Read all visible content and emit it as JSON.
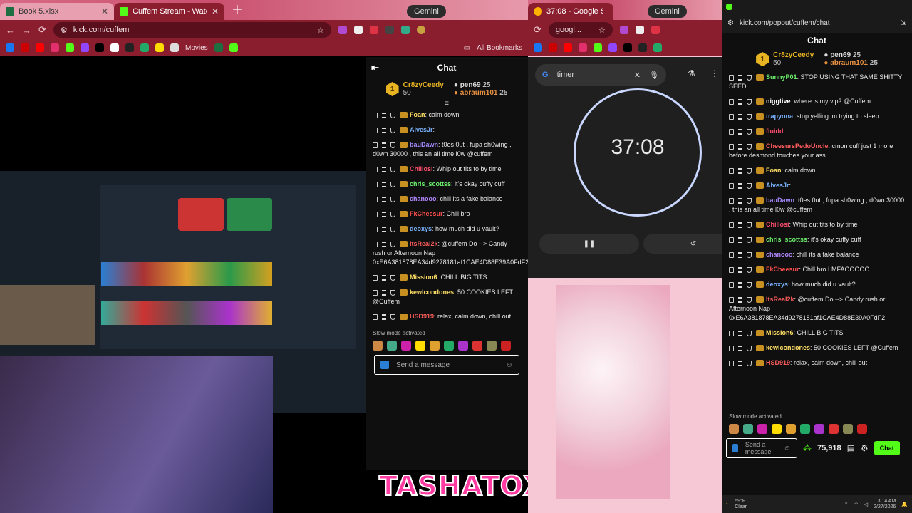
{
  "left_window": {
    "tabs": [
      {
        "label": "Book 5.xlsx",
        "color": "#1d6f42"
      },
      {
        "label": "Cuffem Stream - Watch Li...",
        "color": "#53fc18"
      }
    ],
    "gemini": "Gemini",
    "url": "kick.com/cuffem",
    "bookmarks_movies": "Movies",
    "all_bookmarks": "All Bookmarks"
  },
  "stream_chat": {
    "title": "Chat",
    "leaders": [
      {
        "name": "Cr8zyCeedy",
        "score": "50"
      },
      {
        "name": "pen69",
        "score": "25"
      },
      {
        "name": "abraum101",
        "score": "25"
      }
    ],
    "messages": [
      {
        "user": "Foan",
        "color": "#ffe066",
        "text": ": calm down"
      },
      {
        "user": "AlvesJr",
        "color": "#7ab3ff",
        "text": ":"
      },
      {
        "user": "bauDawn",
        "color": "#a58bff",
        "text": ": t0es 0ut , fupa sh0wing , d0wn 30000 , this an all time l0w @cuffem"
      },
      {
        "user": "Chillosi",
        "color": "#ff4d6d",
        "text": ": Whip out tits to by time"
      },
      {
        "user": "chris_scottss",
        "color": "#6cf06c",
        "text": ": it's okay cuffy cuff"
      },
      {
        "user": "chanooo",
        "color": "#b388ff",
        "text": ": chill its a fake balance"
      },
      {
        "user": "FkCheesur",
        "color": "#ff4d4d",
        "text": ": Chill bro"
      },
      {
        "user": "deoxys",
        "color": "#7ab3ff",
        "text": ": how much did u vault?"
      },
      {
        "user": "ItsReal2k",
        "color": "#ff5c5c",
        "text": ": @cuffem Do --> Candy rush or Afternoon Nap 0xE6A381878EA34d9278181af1CAE4D88E39A0FdF2"
      },
      {
        "user": "Mission6",
        "color": "#ffe066",
        "text": ": CHILL BIG TITS"
      },
      {
        "user": "kewlcondones",
        "color": "#ffe066",
        "text": ": 50 COOKIES LEFT @Cuffem"
      },
      {
        "user": "HSD919",
        "color": "#ff5c5c",
        "text": ": relax, calm down, chill out"
      }
    ],
    "slow_mode": "Slow mode activated",
    "send_placeholder": "Send a message"
  },
  "middle_window": {
    "tab": "37:08 - Google S...",
    "gemini": "Gemini",
    "omnibox": "googl...",
    "search": "timer",
    "timer_value": "37:08"
  },
  "popout_window": {
    "url": "kick.com/popout/cuffem/chat",
    "title": "Chat",
    "leaders": [
      {
        "name": "Cr8zyCeedy",
        "score": "50"
      },
      {
        "name": "pen69",
        "score": "25"
      },
      {
        "name": "abraum101",
        "score": "25"
      }
    ],
    "messages": [
      {
        "user": "SunnyP01",
        "color": "#6cf06c",
        "text": ": STOP USING THAT SAME SHITTY SEED"
      },
      {
        "user": "niggtive",
        "color": "#ffffff",
        "text": ": where is my vip? @Cuffem"
      },
      {
        "user": "trapyona",
        "color": "#7ab3ff",
        "text": ": stop yelling im trying to sleep"
      },
      {
        "user": "fluidd",
        "color": "#ff4d6d",
        "text": ":"
      },
      {
        "user": "CheesursPedoUncle",
        "color": "#ff5c5c",
        "text": ": cmon cuff just 1 more before desmond touches your ass"
      },
      {
        "user": "Foan",
        "color": "#ffe066",
        "text": ": calm down"
      },
      {
        "user": "AlvesJr",
        "color": "#7ab3ff",
        "text": ":"
      },
      {
        "user": "bauDawn",
        "color": "#a58bff",
        "text": ": t0es 0ut , fupa sh0wing , d0wn 30000 , this an all time l0w @cuffem"
      },
      {
        "user": "Chillosi",
        "color": "#ff4d6d",
        "text": ": Whip out tits to by time"
      },
      {
        "user": "chris_scottss",
        "color": "#6cf06c",
        "text": ": it's okay cuffy cuff"
      },
      {
        "user": "chanooo",
        "color": "#b388ff",
        "text": ": chill its a fake balance"
      },
      {
        "user": "FkCheesur",
        "color": "#ff4d4d",
        "text": ": Chill bro  LMFAOOOOO"
      },
      {
        "user": "deoxys",
        "color": "#7ab3ff",
        "text": ": how much did u vault?"
      },
      {
        "user": "ItsReal2k",
        "color": "#ff5c5c",
        "text": ": @cuffem Do --> Candy rush or Afternoon Nap 0xE6A381878EA34d9278181af1CAE4D88E39A0FdF2"
      },
      {
        "user": "Mission6",
        "color": "#ffe066",
        "text": ": CHILL BIG TITS"
      },
      {
        "user": "kewlcondones",
        "color": "#ffe066",
        "text": ": 50 COOKIES LEFT @Cuffem"
      },
      {
        "user": "HSD919",
        "color": "#ff5c5c",
        "text": ": relax, calm down, chill out"
      }
    ],
    "slow_mode": "Slow mode activated",
    "send_placeholder": "Send a message",
    "points": "75,918",
    "chat_button": "Chat"
  },
  "overlay_name": "TASHATOXIC",
  "taskbar": {
    "weather_temp": "59°F",
    "weather_desc": "Clear",
    "time": "3:14 AM",
    "date": "2/27/2026"
  }
}
